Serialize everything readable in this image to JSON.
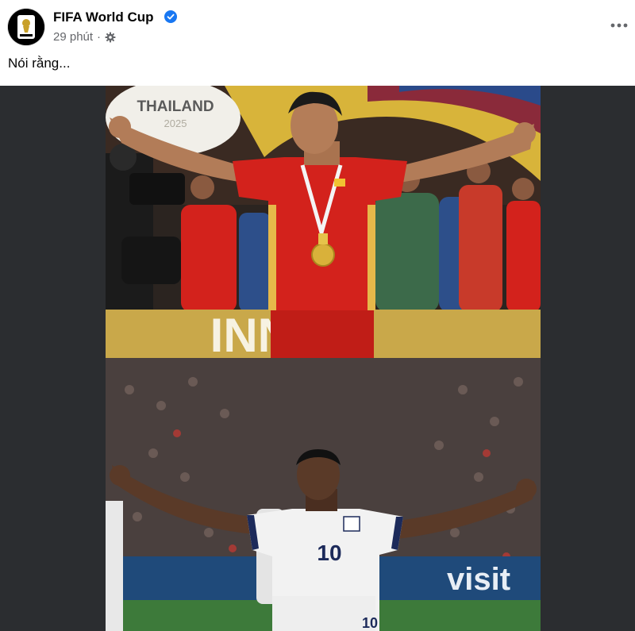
{
  "post": {
    "page_name": "FIFA World Cup",
    "verified": true,
    "time": "29 phút",
    "separator": "·",
    "audience_icon": "gear-icon",
    "caption": "Nói rằng...",
    "more_icon": "more-horizontal-icon"
  },
  "media": {
    "top_banner_text": "THAILAND",
    "top_banner_year": "2025",
    "top_ad_board": "INNER",
    "bottom_ad_board": "visit",
    "jersey_number": "10",
    "shorts_number": "10"
  },
  "colors": {
    "verified": "#1877f2",
    "secondary_text": "#65676b",
    "media_background": "#2b2d30",
    "vietnam_red": "#d3221c",
    "england_white": "#f2f2f2"
  }
}
